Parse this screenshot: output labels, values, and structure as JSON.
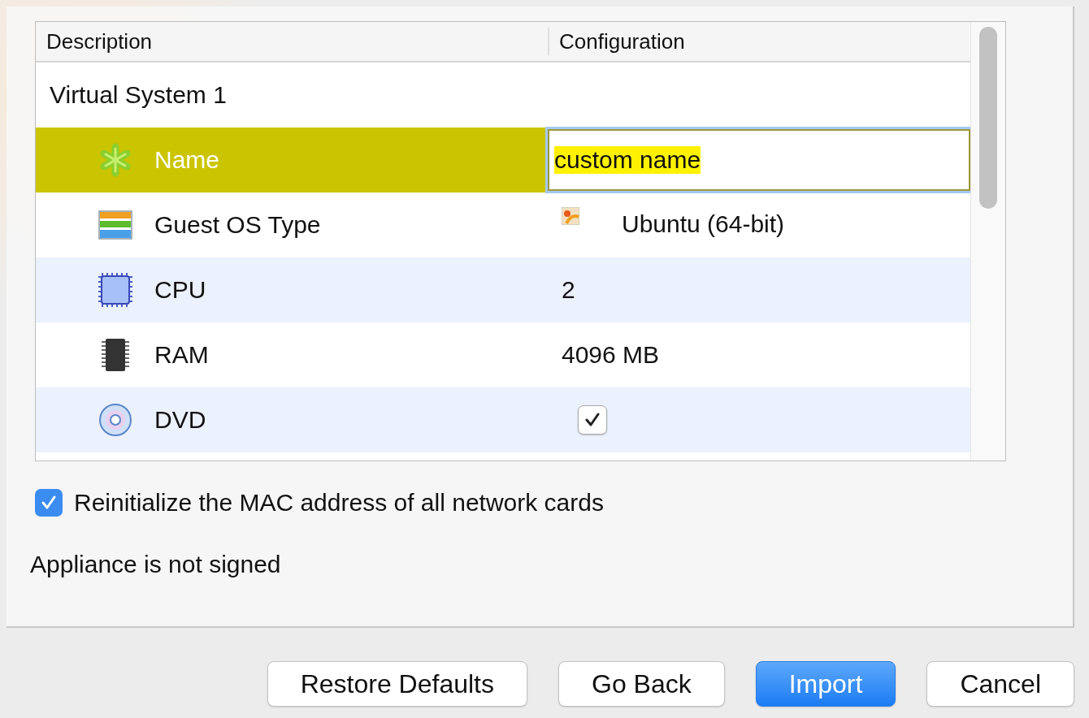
{
  "table": {
    "columns": [
      "Description",
      "Configuration"
    ],
    "rows": [
      {
        "label": "Virtual System 1",
        "children": [
          {
            "kind": "name",
            "label": "Name",
            "value": "custom name",
            "selected": true
          },
          {
            "kind": "ostype",
            "label": "Guest OS Type",
            "value": "Ubuntu (64-bit)",
            "selected": false
          },
          {
            "kind": "cpu",
            "label": "CPU",
            "value": "2",
            "selected": false
          },
          {
            "kind": "ram",
            "label": "RAM",
            "value": "4096 MB",
            "selected": false
          },
          {
            "kind": "dvd",
            "label": "DVD",
            "checked": true,
            "selected": false
          }
        ]
      }
    ]
  },
  "mac_option": {
    "label": "Reinitialize the MAC address of all network cards",
    "checked": true
  },
  "signature_status": "Appliance is not signed",
  "buttons": [
    {
      "label": "Restore Defaults",
      "default": false
    },
    {
      "label": "Go Back",
      "default": false
    },
    {
      "label": "Import",
      "default": true
    },
    {
      "label": "Cancel",
      "default": false
    }
  ]
}
